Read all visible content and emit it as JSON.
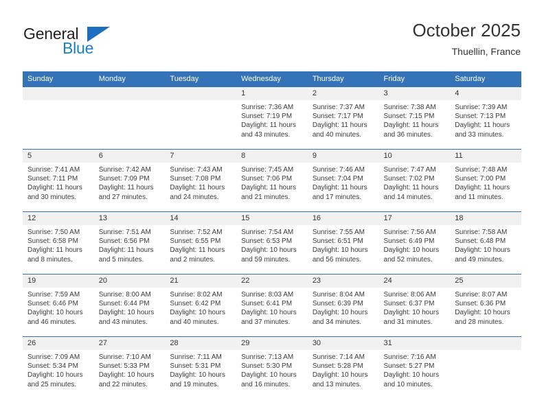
{
  "brand": {
    "name_top": "General",
    "name_bottom": "Blue",
    "flag_icon": "triangle-flag-icon",
    "color_primary": "#1b6ec2",
    "color_text": "#231f20"
  },
  "header": {
    "title": "October 2025",
    "subtitle": "Thuellin, France"
  },
  "theme": {
    "header_row_bg": "#3573b9",
    "daynum_bg": "#f1f1f1",
    "grid_line": "#3573b9",
    "body_text": "#3a3a3a"
  },
  "weekday_headers": [
    "Sunday",
    "Monday",
    "Tuesday",
    "Wednesday",
    "Thursday",
    "Friday",
    "Saturday"
  ],
  "labels": {
    "sunrise_prefix": "Sunrise: ",
    "sunset_prefix": "Sunset: ",
    "daylight_prefix": "Daylight: "
  },
  "weeks": [
    [
      {
        "day": "",
        "empty": true
      },
      {
        "day": "",
        "empty": true
      },
      {
        "day": "",
        "empty": true
      },
      {
        "day": "1",
        "sunrise": "Sunrise: 7:36 AM",
        "sunset": "Sunset: 7:19 PM",
        "daylight": "Daylight: 11 hours and 43 minutes."
      },
      {
        "day": "2",
        "sunrise": "Sunrise: 7:37 AM",
        "sunset": "Sunset: 7:17 PM",
        "daylight": "Daylight: 11 hours and 40 minutes."
      },
      {
        "day": "3",
        "sunrise": "Sunrise: 7:38 AM",
        "sunset": "Sunset: 7:15 PM",
        "daylight": "Daylight: 11 hours and 36 minutes."
      },
      {
        "day": "4",
        "sunrise": "Sunrise: 7:39 AM",
        "sunset": "Sunset: 7:13 PM",
        "daylight": "Daylight: 11 hours and 33 minutes."
      }
    ],
    [
      {
        "day": "5",
        "sunrise": "Sunrise: 7:41 AM",
        "sunset": "Sunset: 7:11 PM",
        "daylight": "Daylight: 11 hours and 30 minutes."
      },
      {
        "day": "6",
        "sunrise": "Sunrise: 7:42 AM",
        "sunset": "Sunset: 7:09 PM",
        "daylight": "Daylight: 11 hours and 27 minutes."
      },
      {
        "day": "7",
        "sunrise": "Sunrise: 7:43 AM",
        "sunset": "Sunset: 7:08 PM",
        "daylight": "Daylight: 11 hours and 24 minutes."
      },
      {
        "day": "8",
        "sunrise": "Sunrise: 7:45 AM",
        "sunset": "Sunset: 7:06 PM",
        "daylight": "Daylight: 11 hours and 21 minutes."
      },
      {
        "day": "9",
        "sunrise": "Sunrise: 7:46 AM",
        "sunset": "Sunset: 7:04 PM",
        "daylight": "Daylight: 11 hours and 17 minutes."
      },
      {
        "day": "10",
        "sunrise": "Sunrise: 7:47 AM",
        "sunset": "Sunset: 7:02 PM",
        "daylight": "Daylight: 11 hours and 14 minutes."
      },
      {
        "day": "11",
        "sunrise": "Sunrise: 7:48 AM",
        "sunset": "Sunset: 7:00 PM",
        "daylight": "Daylight: 11 hours and 11 minutes."
      }
    ],
    [
      {
        "day": "12",
        "sunrise": "Sunrise: 7:50 AM",
        "sunset": "Sunset: 6:58 PM",
        "daylight": "Daylight: 11 hours and 8 minutes."
      },
      {
        "day": "13",
        "sunrise": "Sunrise: 7:51 AM",
        "sunset": "Sunset: 6:56 PM",
        "daylight": "Daylight: 11 hours and 5 minutes."
      },
      {
        "day": "14",
        "sunrise": "Sunrise: 7:52 AM",
        "sunset": "Sunset: 6:55 PM",
        "daylight": "Daylight: 11 hours and 2 minutes."
      },
      {
        "day": "15",
        "sunrise": "Sunrise: 7:54 AM",
        "sunset": "Sunset: 6:53 PM",
        "daylight": "Daylight: 10 hours and 59 minutes."
      },
      {
        "day": "16",
        "sunrise": "Sunrise: 7:55 AM",
        "sunset": "Sunset: 6:51 PM",
        "daylight": "Daylight: 10 hours and 56 minutes."
      },
      {
        "day": "17",
        "sunrise": "Sunrise: 7:56 AM",
        "sunset": "Sunset: 6:49 PM",
        "daylight": "Daylight: 10 hours and 52 minutes."
      },
      {
        "day": "18",
        "sunrise": "Sunrise: 7:58 AM",
        "sunset": "Sunset: 6:48 PM",
        "daylight": "Daylight: 10 hours and 49 minutes."
      }
    ],
    [
      {
        "day": "19",
        "sunrise": "Sunrise: 7:59 AM",
        "sunset": "Sunset: 6:46 PM",
        "daylight": "Daylight: 10 hours and 46 minutes."
      },
      {
        "day": "20",
        "sunrise": "Sunrise: 8:00 AM",
        "sunset": "Sunset: 6:44 PM",
        "daylight": "Daylight: 10 hours and 43 minutes."
      },
      {
        "day": "21",
        "sunrise": "Sunrise: 8:02 AM",
        "sunset": "Sunset: 6:42 PM",
        "daylight": "Daylight: 10 hours and 40 minutes."
      },
      {
        "day": "22",
        "sunrise": "Sunrise: 8:03 AM",
        "sunset": "Sunset: 6:41 PM",
        "daylight": "Daylight: 10 hours and 37 minutes."
      },
      {
        "day": "23",
        "sunrise": "Sunrise: 8:04 AM",
        "sunset": "Sunset: 6:39 PM",
        "daylight": "Daylight: 10 hours and 34 minutes."
      },
      {
        "day": "24",
        "sunrise": "Sunrise: 8:06 AM",
        "sunset": "Sunset: 6:37 PM",
        "daylight": "Daylight: 10 hours and 31 minutes."
      },
      {
        "day": "25",
        "sunrise": "Sunrise: 8:07 AM",
        "sunset": "Sunset: 6:36 PM",
        "daylight": "Daylight: 10 hours and 28 minutes."
      }
    ],
    [
      {
        "day": "26",
        "sunrise": "Sunrise: 7:09 AM",
        "sunset": "Sunset: 5:34 PM",
        "daylight": "Daylight: 10 hours and 25 minutes."
      },
      {
        "day": "27",
        "sunrise": "Sunrise: 7:10 AM",
        "sunset": "Sunset: 5:33 PM",
        "daylight": "Daylight: 10 hours and 22 minutes."
      },
      {
        "day": "28",
        "sunrise": "Sunrise: 7:11 AM",
        "sunset": "Sunset: 5:31 PM",
        "daylight": "Daylight: 10 hours and 19 minutes."
      },
      {
        "day": "29",
        "sunrise": "Sunrise: 7:13 AM",
        "sunset": "Sunset: 5:30 PM",
        "daylight": "Daylight: 10 hours and 16 minutes."
      },
      {
        "day": "30",
        "sunrise": "Sunrise: 7:14 AM",
        "sunset": "Sunset: 5:28 PM",
        "daylight": "Daylight: 10 hours and 13 minutes."
      },
      {
        "day": "31",
        "sunrise": "Sunrise: 7:16 AM",
        "sunset": "Sunset: 5:27 PM",
        "daylight": "Daylight: 10 hours and 10 minutes."
      },
      {
        "day": "",
        "empty": true
      }
    ]
  ]
}
